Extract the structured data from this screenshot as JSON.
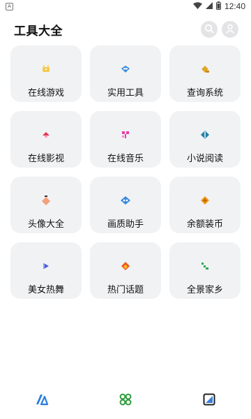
{
  "status_bar": {
    "app_icon": "A",
    "time": "12:40",
    "icons": [
      "wifi-icon",
      "signal-icon",
      "battery-icon"
    ],
    "battery_label": "b"
  },
  "header": {
    "title": "工具大全",
    "actions": [
      "search-icon",
      "user-icon"
    ]
  },
  "tools": [
    {
      "label": "在线游戏",
      "icon": "game-icon",
      "color": "#f3c94d"
    },
    {
      "label": "实用工具",
      "icon": "tools-icon",
      "color": "#3b8de0"
    },
    {
      "label": "查询系统",
      "icon": "query-icon",
      "color": "#e0a82a"
    },
    {
      "label": "在线影视",
      "icon": "video-icon",
      "color": "#e23a55"
    },
    {
      "label": "在线音乐",
      "icon": "music-icon",
      "color": "#ea3fa7"
    },
    {
      "label": "小说阅读",
      "icon": "book-icon",
      "color": "#1f7fa8"
    },
    {
      "label": "头像大全",
      "icon": "avatar-icon",
      "color": "#f4a07a"
    },
    {
      "label": "画质助手",
      "icon": "quality-icon",
      "color": "#3a8be0"
    },
    {
      "label": "余额装币",
      "icon": "coin-icon",
      "color": "#f29a1c"
    },
    {
      "label": "美女热舞",
      "icon": "dance-icon",
      "color": "#4a5cd8"
    },
    {
      "label": "热门话题",
      "icon": "hot-topic-icon",
      "color": "#ee5a1c"
    },
    {
      "label": "全景家乡",
      "icon": "panorama-icon",
      "color": "#2fa84f"
    }
  ],
  "bottom_nav": [
    {
      "icon": "home-icon",
      "color": "#2a7de1"
    },
    {
      "icon": "apps-icon",
      "color": "#2e9b3d"
    },
    {
      "icon": "gallery-icon",
      "color": "#3a7fd8"
    }
  ]
}
